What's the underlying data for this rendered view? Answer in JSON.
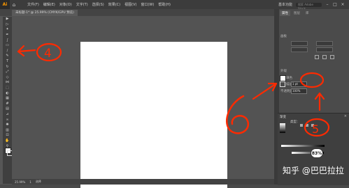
{
  "app": {
    "logo_text": "Ai",
    "home_icon": "home-icon"
  },
  "menu": {
    "items": [
      "文件(F)",
      "编辑(E)",
      "对象(O)",
      "文字(T)",
      "选择(S)",
      "效果(C)",
      "视图(V)",
      "窗口(W)",
      "帮助(H)"
    ]
  },
  "topbar": {
    "workspace_label": "基本功能",
    "search_placeholder": "搜索 Adobe Stock"
  },
  "document": {
    "tab_label": "未标题-1* @ 25.99% (CMYK/GPU 预览)"
  },
  "statusbar": {
    "zoom": "25.99%",
    "page": "1",
    "tool": "选择"
  },
  "panel": {
    "tabs": [
      "属性",
      "图层",
      "库"
    ],
    "section_artboard": "画板",
    "section_appearance": "外观",
    "fill_label": "填色",
    "stroke_label": "描边",
    "stroke_value": "1 pt",
    "opacity_label": "不透明度",
    "opacity_value": "100%"
  },
  "gradient_panel": {
    "title": "渐变",
    "type_label": "类型："
  },
  "badge": {
    "percent": "83%",
    "sub_label": "不透明度\n位置"
  },
  "watermark": "知乎 @巴巴拉拉",
  "annotations": {
    "n4": "4",
    "n6": "6",
    "n5": "5"
  },
  "colors": {
    "annotation": "#ff2a00",
    "accent_logo": "#ff9a00"
  }
}
